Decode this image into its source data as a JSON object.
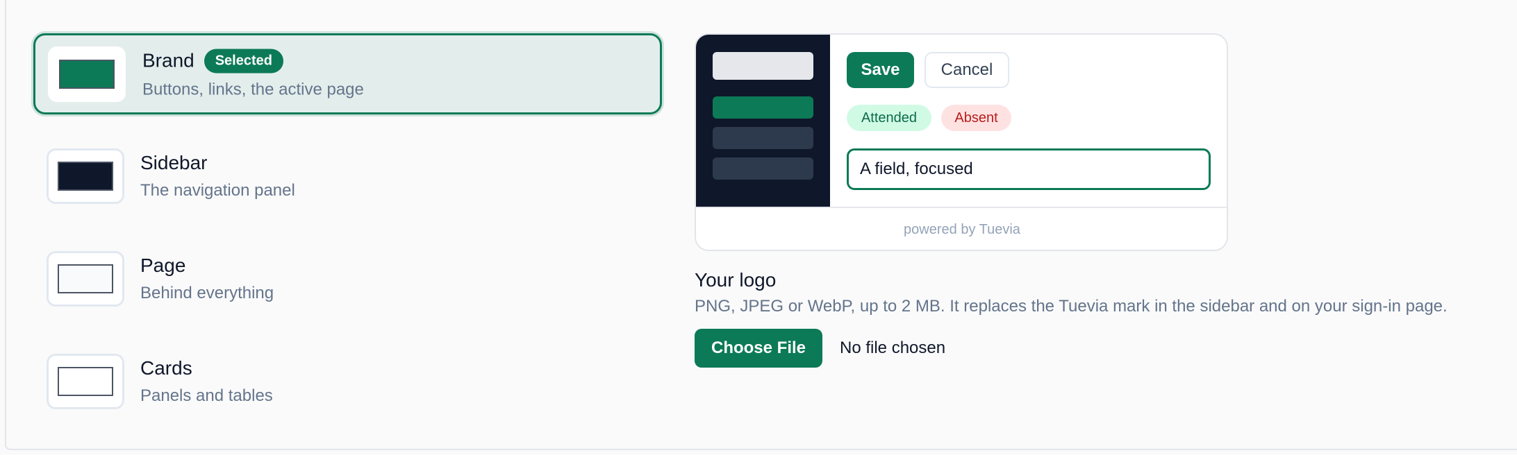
{
  "options": [
    {
      "title": "Brand",
      "desc": "Buttons, links, the active page",
      "badge": "Selected",
      "swatch": "#0c7a56"
    },
    {
      "title": "Sidebar",
      "desc": "The navigation panel",
      "swatch": "#0f172a"
    },
    {
      "title": "Page",
      "desc": "Behind everything",
      "swatch": "#f8fafc"
    },
    {
      "title": "Cards",
      "desc": "Panels and tables",
      "swatch": "#ffffff"
    }
  ],
  "preview": {
    "save_label": "Save",
    "cancel_label": "Cancel",
    "attended_label": "Attended",
    "absent_label": "Absent",
    "field_value": "A field, focused",
    "footer": "powered by Tuevia"
  },
  "logo": {
    "title": "Your logo",
    "help": "PNG, JPEG or WebP, up to 2 MB. It replaces the Tuevia mark in the sidebar and on your sign-in page.",
    "choose_label": "Choose File",
    "no_file": "No file chosen"
  },
  "colors": {
    "brand": "#0c7a56",
    "sidebar": "#0f172a",
    "page": "#f8fafc",
    "cards": "#ffffff"
  }
}
